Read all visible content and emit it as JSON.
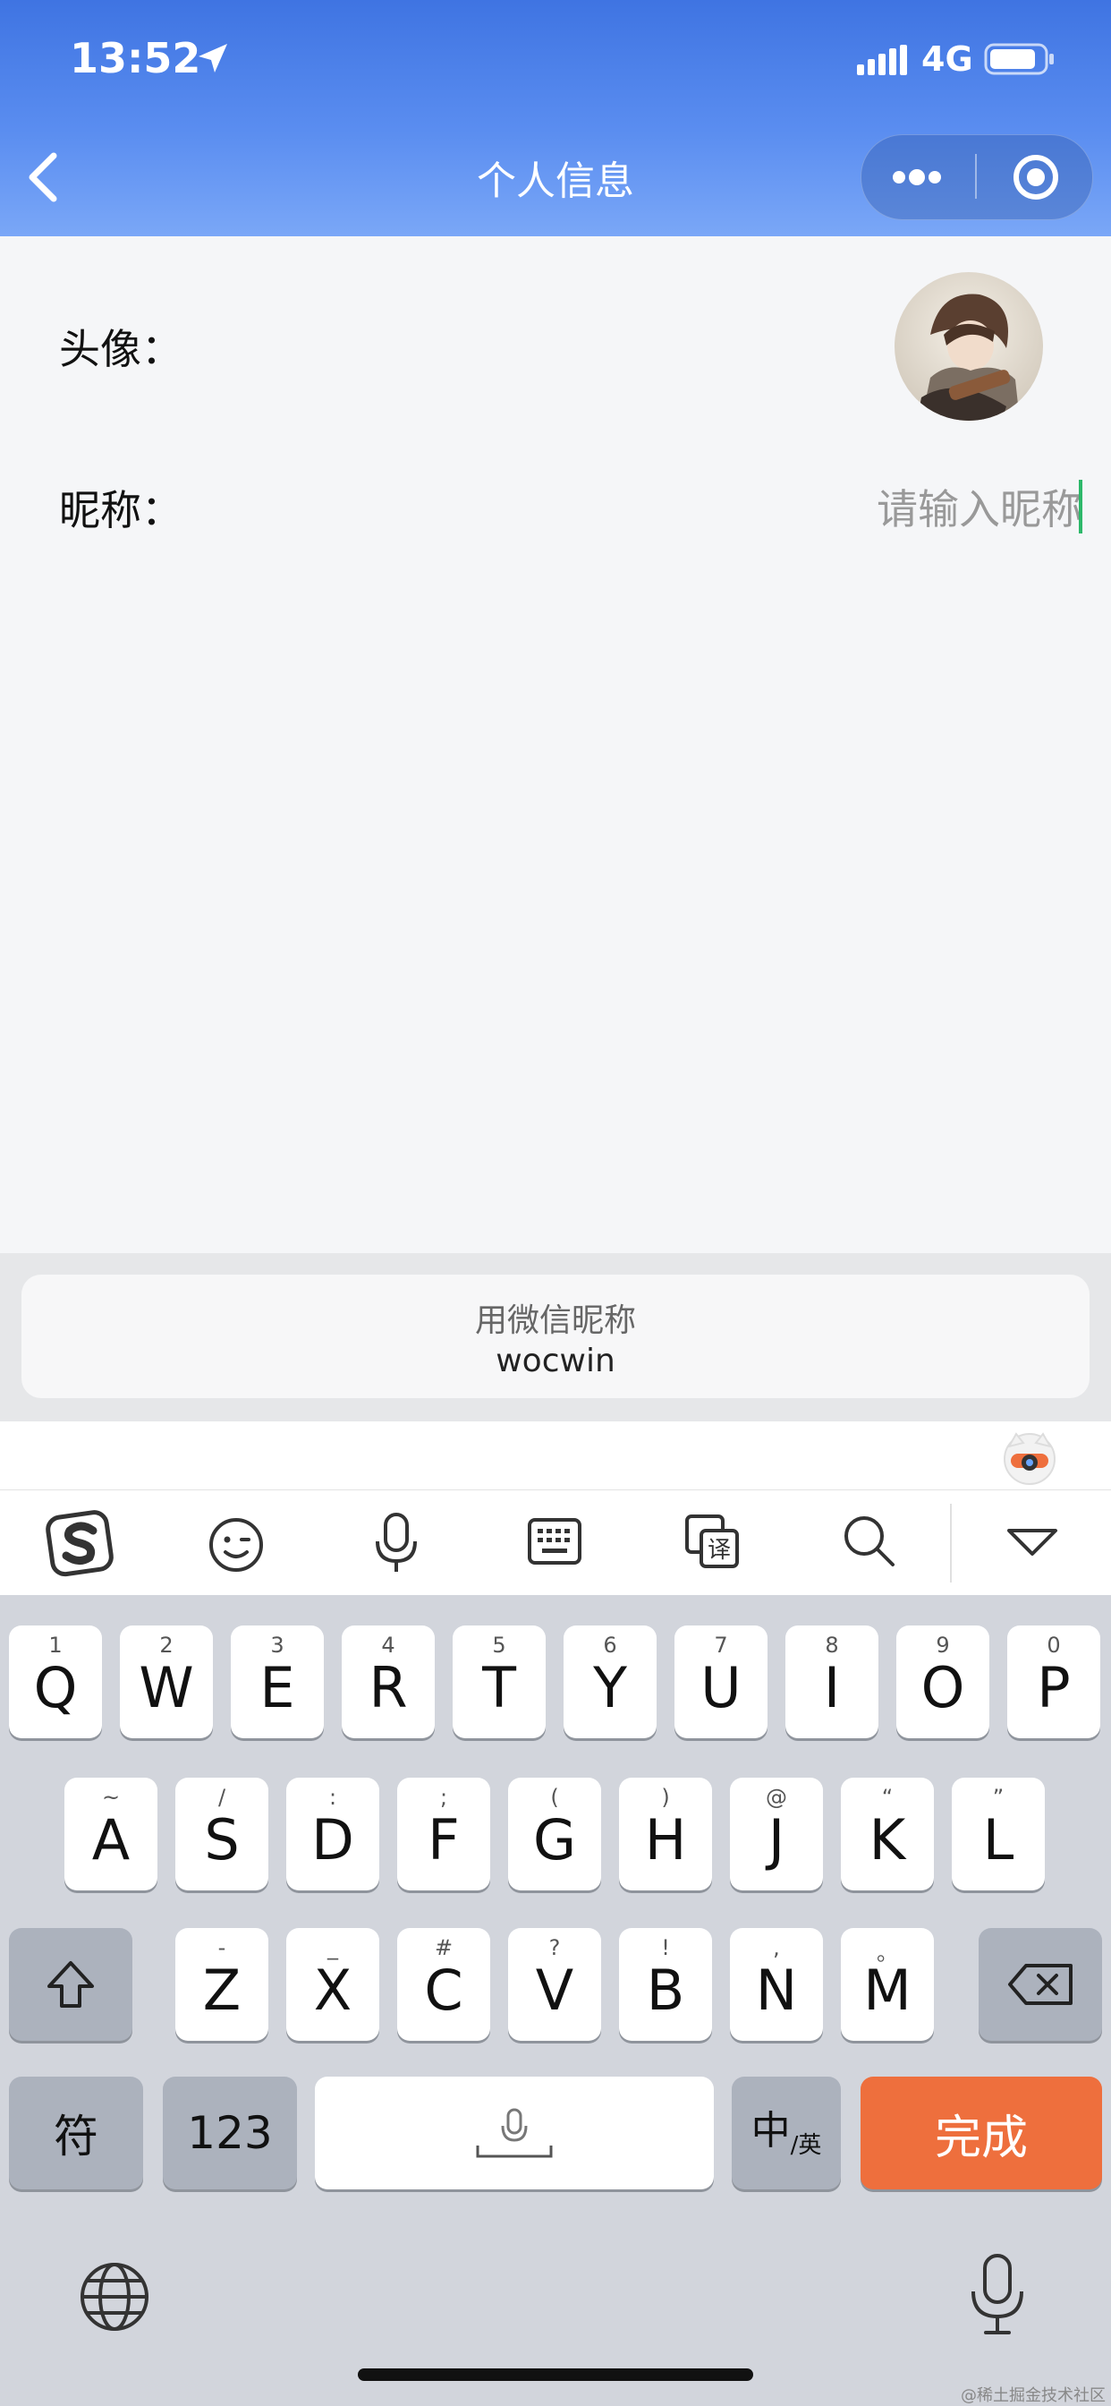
{
  "status_bar": {
    "time": "13:52",
    "network": "4G"
  },
  "nav": {
    "title": "个人信息"
  },
  "form": {
    "avatar_label": "头像：",
    "nickname_label": "昵称：",
    "nickname_placeholder": "请输入昵称"
  },
  "suggestion": {
    "title": "用微信昵称",
    "name": "wocwin"
  },
  "keyboard": {
    "row1": [
      {
        "main": "Q",
        "sub": "1"
      },
      {
        "main": "W",
        "sub": "2"
      },
      {
        "main": "E",
        "sub": "3"
      },
      {
        "main": "R",
        "sub": "4"
      },
      {
        "main": "T",
        "sub": "5"
      },
      {
        "main": "Y",
        "sub": "6"
      },
      {
        "main": "U",
        "sub": "7"
      },
      {
        "main": "I",
        "sub": "8"
      },
      {
        "main": "O",
        "sub": "9"
      },
      {
        "main": "P",
        "sub": "0"
      }
    ],
    "row2": [
      {
        "main": "A",
        "sub": "~"
      },
      {
        "main": "S",
        "sub": "/"
      },
      {
        "main": "D",
        "sub": ":"
      },
      {
        "main": "F",
        "sub": ";"
      },
      {
        "main": "G",
        "sub": "("
      },
      {
        "main": "H",
        "sub": ")"
      },
      {
        "main": "J",
        "sub": "@"
      },
      {
        "main": "K",
        "sub": "“"
      },
      {
        "main": "L",
        "sub": "”"
      }
    ],
    "row3": [
      {
        "main": "Z",
        "sub": "-"
      },
      {
        "main": "X",
        "sub": "_"
      },
      {
        "main": "C",
        "sub": "#"
      },
      {
        "main": "V",
        "sub": "?"
      },
      {
        "main": "B",
        "sub": "!"
      },
      {
        "main": "N",
        "sub": ","
      },
      {
        "main": "M",
        "sub": "。"
      }
    ],
    "symbols_label": "符",
    "numbers_label": "123",
    "lang_main": "中",
    "lang_sub": "/英",
    "done_label": "完成"
  },
  "watermark": "@稀土掘金技术社区",
  "colors": {
    "header": "#4a7ee8",
    "accent_done": "#ee6f3d",
    "caret": "#2db86a"
  }
}
